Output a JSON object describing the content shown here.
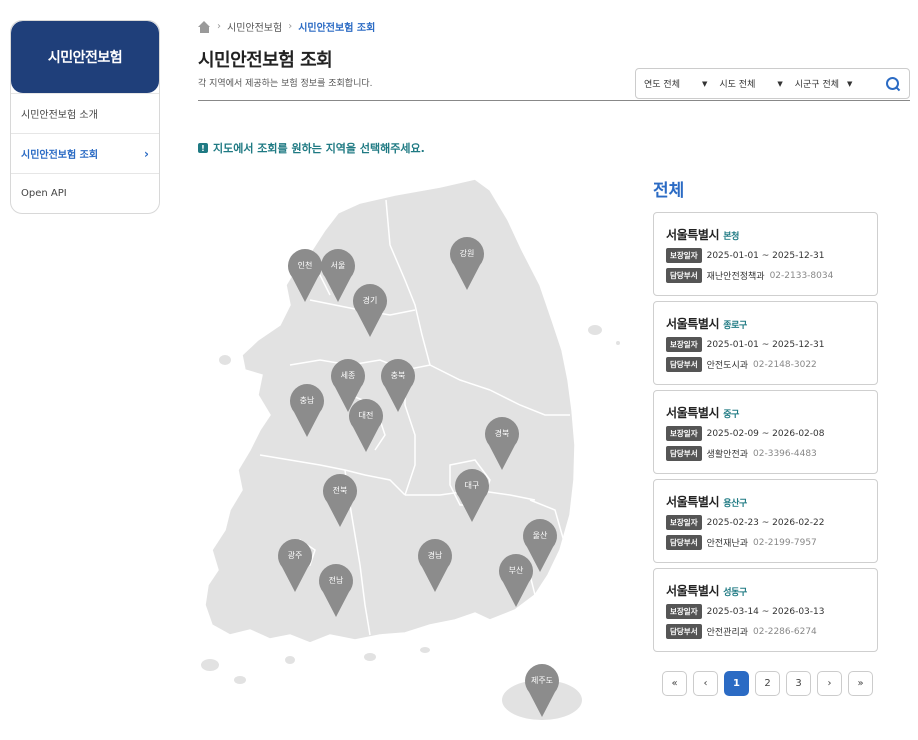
{
  "sidebar": {
    "title": "시민안전보험",
    "items": [
      {
        "label": "시민안전보험 소개"
      },
      {
        "label": "시민안전보험 조회",
        "active": true
      },
      {
        "label": "Open API"
      }
    ]
  },
  "breadcrumb": {
    "items": [
      "시민안전보험",
      "시민안전보험 조회"
    ]
  },
  "page": {
    "title": "시민안전보험 조회",
    "subtitle": "각 지역에서 제공하는 보험 정보를 조회합니다."
  },
  "filters": {
    "year": "연도 전체",
    "province": "시도 전체",
    "district": "시군구 전체"
  },
  "notice": "지도에서 조회를 원하는 지역을 선택해주세요.",
  "map": {
    "pins": [
      "인천",
      "서울",
      "경기",
      "강원",
      "세종",
      "충북",
      "충남",
      "대전",
      "경북",
      "전북",
      "대구",
      "울산",
      "광주",
      "경남",
      "부산",
      "전남",
      "제주도"
    ]
  },
  "results": {
    "heading": "전체",
    "badge_period": "보장일자",
    "badge_dept": "담당부서",
    "cards": [
      {
        "city": "서울특별시",
        "district": "본청",
        "period": "2025-01-01 ~ 2025-12-31",
        "dept": "재난안전정책과",
        "phone": "02-2133-8034"
      },
      {
        "city": "서울특별시",
        "district": "종로구",
        "period": "2025-01-01 ~ 2025-12-31",
        "dept": "안전도시과",
        "phone": "02-2148-3022"
      },
      {
        "city": "서울특별시",
        "district": "중구",
        "period": "2025-02-09 ~ 2026-02-08",
        "dept": "생활안전과",
        "phone": "02-3396-4483"
      },
      {
        "city": "서울특별시",
        "district": "용산구",
        "period": "2025-02-23 ~ 2026-02-22",
        "dept": "안전재난과",
        "phone": "02-2199-7957"
      },
      {
        "city": "서울특별시",
        "district": "성동구",
        "period": "2025-03-14 ~ 2026-03-13",
        "dept": "안전관리과",
        "phone": "02-2286-6274"
      }
    ]
  },
  "pagination": {
    "first": "«",
    "prev": "‹",
    "pages": [
      "1",
      "2",
      "3"
    ],
    "current": "1",
    "next": "›",
    "last": "»"
  },
  "colors": {
    "brand": "#1f3f7a",
    "accent": "#2b6bc4",
    "teal": "#1f7a83",
    "map": "#e2e2e2",
    "pin": "#8c8c8c"
  }
}
